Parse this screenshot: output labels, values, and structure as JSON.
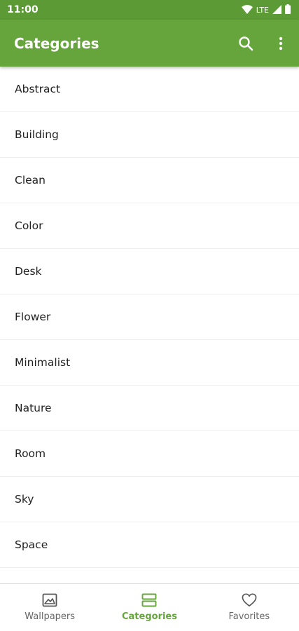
{
  "status_bar": {
    "time": "11:00",
    "network": "LTE"
  },
  "app_bar": {
    "title": "Categories",
    "search_icon": "search-icon",
    "more_icon": "more-vertical-icon"
  },
  "categories": [
    {
      "label": "Abstract"
    },
    {
      "label": "Building"
    },
    {
      "label": "Clean"
    },
    {
      "label": "Color"
    },
    {
      "label": "Desk"
    },
    {
      "label": "Flower"
    },
    {
      "label": "Minimalist"
    },
    {
      "label": "Nature"
    },
    {
      "label": "Room"
    },
    {
      "label": "Sky"
    },
    {
      "label": "Space"
    }
  ],
  "bottom_nav": {
    "items": [
      {
        "label": "Wallpapers",
        "icon": "image-icon",
        "active": false
      },
      {
        "label": "Categories",
        "icon": "categories-icon",
        "active": true
      },
      {
        "label": "Favorites",
        "icon": "heart-icon",
        "active": false
      }
    ]
  },
  "colors": {
    "app_bar": "#66a53b",
    "status_bar": "#5c9a36",
    "active_nav": "#66a53b",
    "inactive_nav": "#666666"
  }
}
